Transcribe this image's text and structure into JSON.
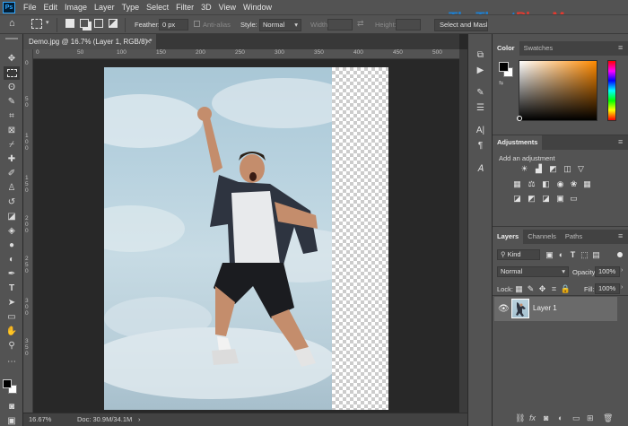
{
  "menu": {
    "items": [
      "File",
      "Edit",
      "Image",
      "Layer",
      "Type",
      "Select",
      "Filter",
      "3D",
      "View",
      "Window"
    ],
    "app_logo_text": "Ps"
  },
  "options": {
    "feather_label": "Feather:",
    "feather_value": "0 px",
    "antialias_label": "Anti-alias",
    "style_label": "Style:",
    "style_value": "Normal",
    "width_label": "Width:",
    "height_label": "Height:",
    "select_mask_button": "Select and Mask..."
  },
  "document": {
    "tab_title": "Demo.jpg @ 16.7% (Layer 1, RGB/8) *",
    "ruler_h": [
      "0",
      "50",
      "100",
      "150",
      "200",
      "250",
      "300",
      "350",
      "400",
      "450",
      "500"
    ],
    "ruler_v": [
      "0",
      "5",
      "0",
      "1",
      "0",
      "0",
      "1",
      "5",
      "0",
      "2",
      "0",
      "0",
      "2",
      "5",
      "0",
      "3",
      "0",
      "0",
      "3",
      "5",
      "0"
    ],
    "zoom": "16.67%",
    "doc_size": "Doc: 30.9M/34.1M"
  },
  "panels": {
    "color_tabs": [
      "Color",
      "Swatches"
    ],
    "adjustments_tab": "Adjustments",
    "adjustments_hint": "Add an adjustment",
    "layers_tabs": [
      "Layers",
      "Channels",
      "Paths"
    ],
    "kind_filter": "Kind",
    "blend_mode": "Normal",
    "opacity_label": "Opacity:",
    "opacity_value": "100%",
    "lock_label": "Lock:",
    "fill_label": "Fill:",
    "fill_value": "100%",
    "layers": [
      {
        "name": "Layer 1",
        "visible": true,
        "selected": true
      }
    ]
  },
  "colors": {
    "foreground": "#000000",
    "background": "#ffffff",
    "accent": "#31a8ff"
  },
  "watermark": {
    "part1": "ThuThuat",
    "part2": "PhanMem",
    "part3": ".vn"
  }
}
